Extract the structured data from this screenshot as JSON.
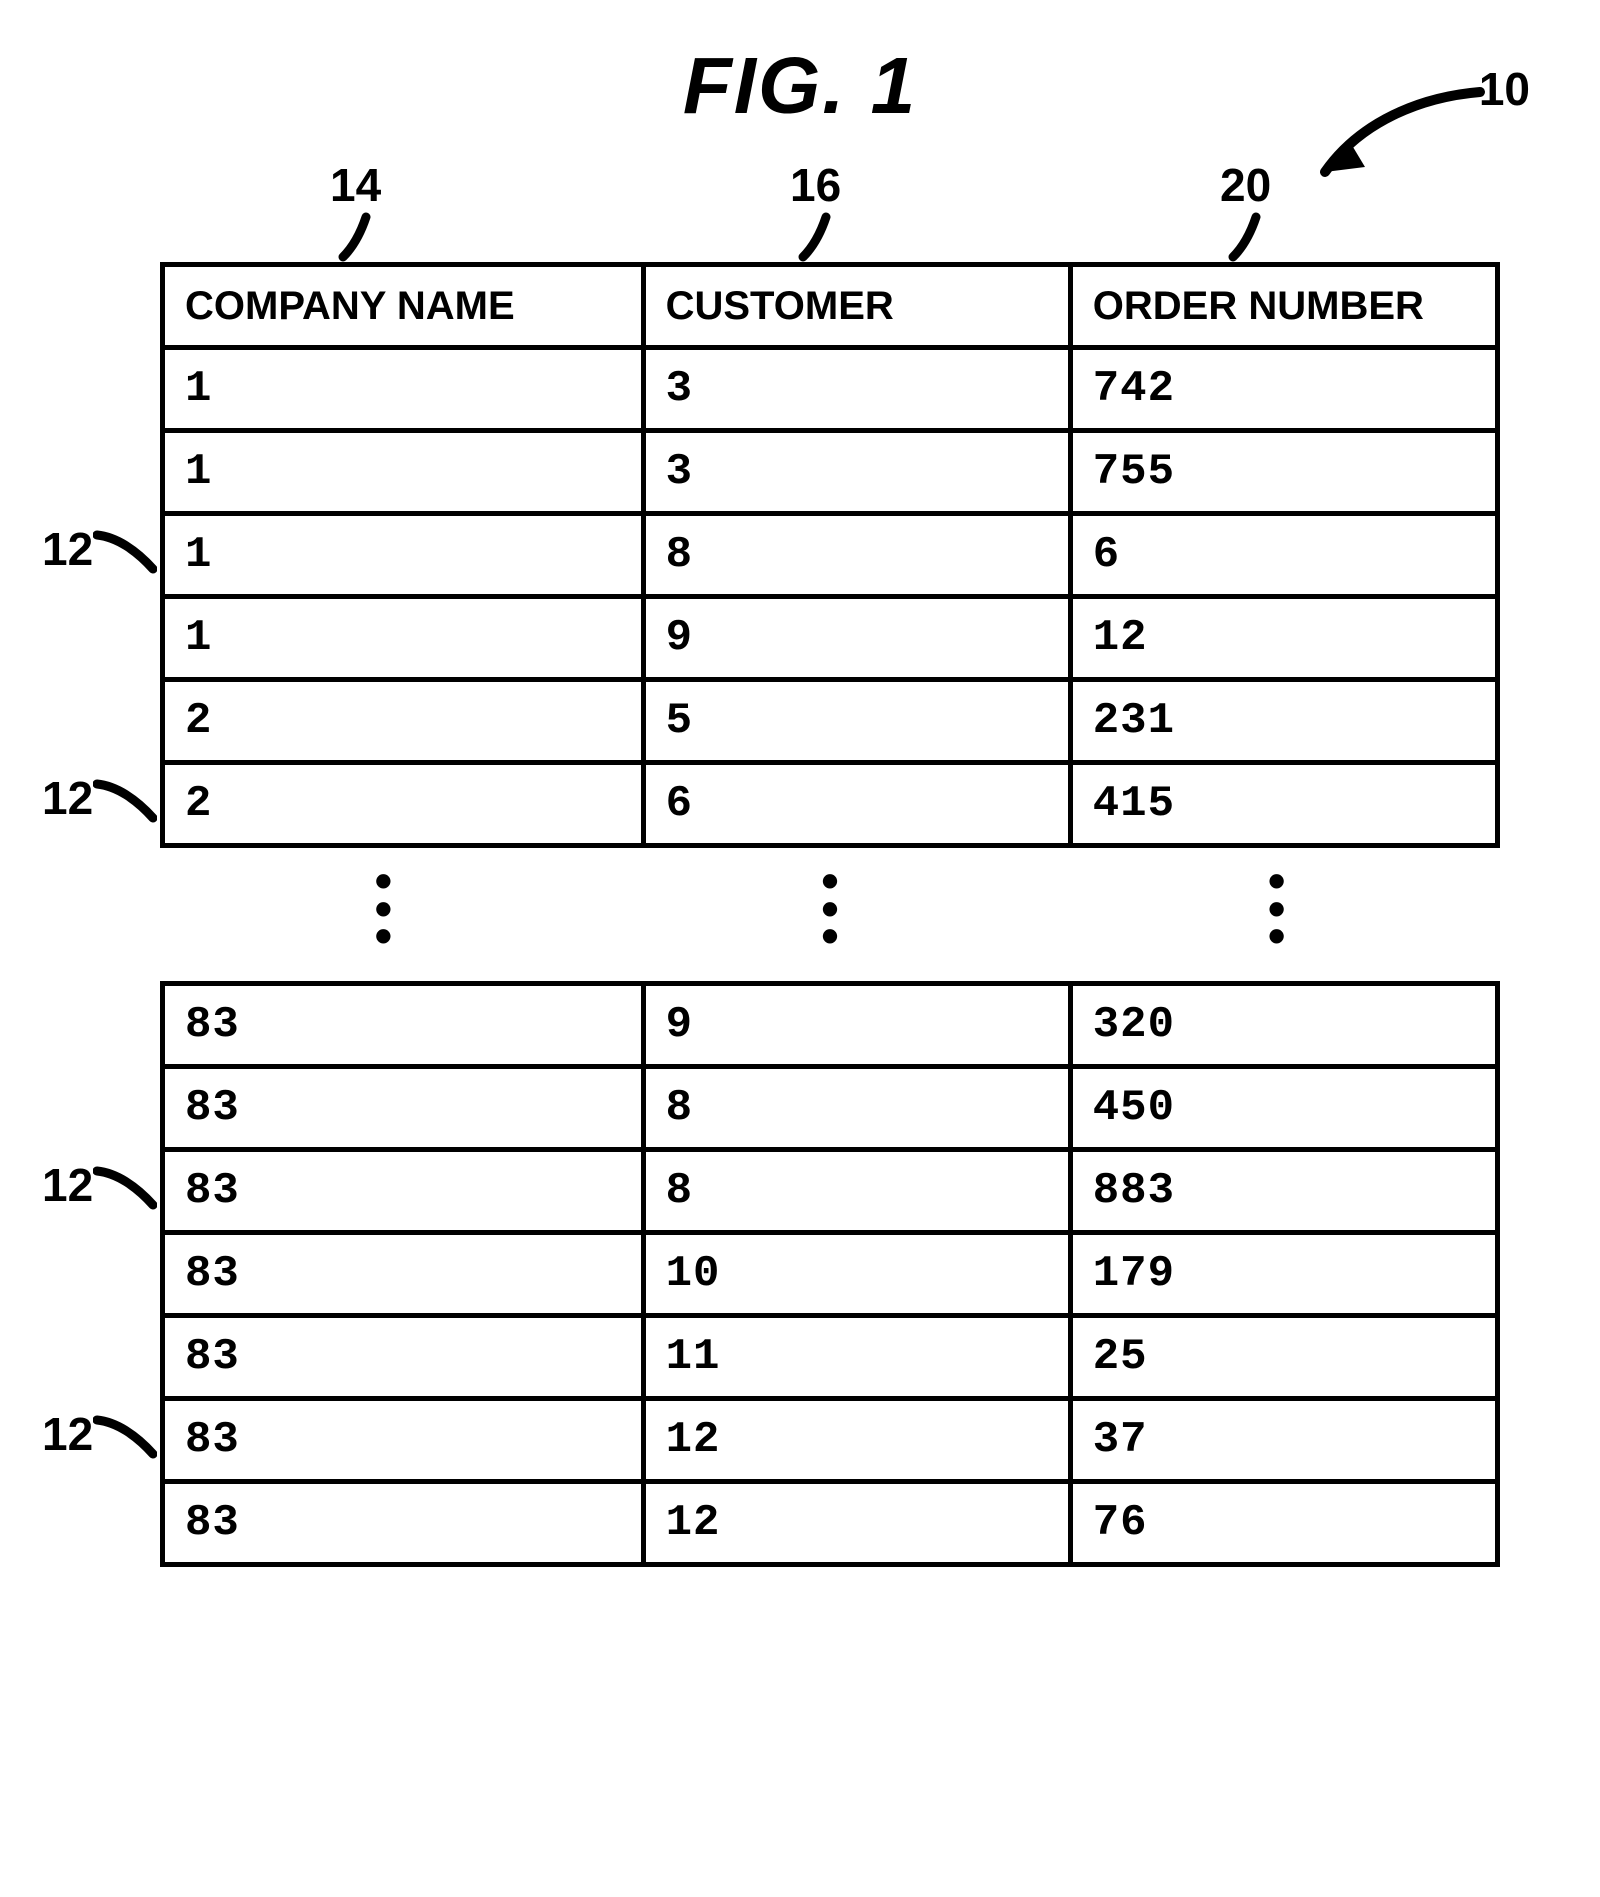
{
  "figure_title": "FIG. 1",
  "reference_numerals": {
    "table": "10",
    "row": "12",
    "col_company": "14",
    "col_customer": "16",
    "col_order": "20"
  },
  "columns": {
    "company_name": "COMPANY NAME",
    "customer": "CUSTOMER",
    "order_number": "ORDER NUMBER"
  },
  "rows_top": [
    {
      "company_name": "1",
      "customer": "3",
      "order_number": "742"
    },
    {
      "company_name": "1",
      "customer": "3",
      "order_number": "755"
    },
    {
      "company_name": "1",
      "customer": "8",
      "order_number": "6"
    },
    {
      "company_name": "1",
      "customer": "9",
      "order_number": "12"
    },
    {
      "company_name": "2",
      "customer": "5",
      "order_number": "231"
    },
    {
      "company_name": "2",
      "customer": "6",
      "order_number": "415"
    }
  ],
  "rows_bottom": [
    {
      "company_name": "83",
      "customer": "9",
      "order_number": "320"
    },
    {
      "company_name": "83",
      "customer": "8",
      "order_number": "450"
    },
    {
      "company_name": "83",
      "customer": "8",
      "order_number": "883"
    },
    {
      "company_name": "83",
      "customer": "10",
      "order_number": "179"
    },
    {
      "company_name": "83",
      "customer": "11",
      "order_number": "25"
    },
    {
      "company_name": "83",
      "customer": "12",
      "order_number": "37"
    },
    {
      "company_name": "83",
      "customer": "12",
      "order_number": "76"
    }
  ],
  "row_ref_positions_top": [
    2,
    5
  ],
  "row_ref_positions_bottom": [
    2,
    5
  ]
}
